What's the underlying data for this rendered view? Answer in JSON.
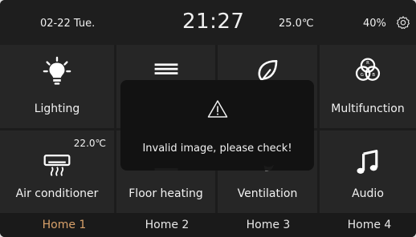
{
  "status_bar": {
    "date": "02-22  Tue.",
    "time": "21:27",
    "temperature": "25.0℃",
    "humidity": "40%",
    "settings_icon": "gear-icon"
  },
  "tiles": [
    {
      "label": "Lighting",
      "icon": "lightbulb-icon"
    },
    {
      "label": "",
      "icon": "curtain-icon"
    },
    {
      "label": "",
      "icon": "leaf-icon"
    },
    {
      "label": "Multifunction",
      "icon": "rgb-circles-icon"
    },
    {
      "label": "Air conditioner",
      "icon": "air-conditioner-icon",
      "setpoint": "22.0℃"
    },
    {
      "label": "Floor heating",
      "icon": "floor-heating-icon"
    },
    {
      "label": "Ventilation",
      "icon": "ventilation-icon"
    },
    {
      "label": "Audio",
      "icon": "music-note-icon"
    }
  ],
  "tabs": [
    {
      "label": "Home 1",
      "active": true
    },
    {
      "label": "Home 2",
      "active": false
    },
    {
      "label": "Home 3",
      "active": false
    },
    {
      "label": "Home 4",
      "active": false
    }
  ],
  "dialog": {
    "icon": "warning-icon",
    "message": "Invalid image, please check!"
  },
  "colors": {
    "active_tab": "#d8a16a",
    "tile_background": "#262626"
  }
}
